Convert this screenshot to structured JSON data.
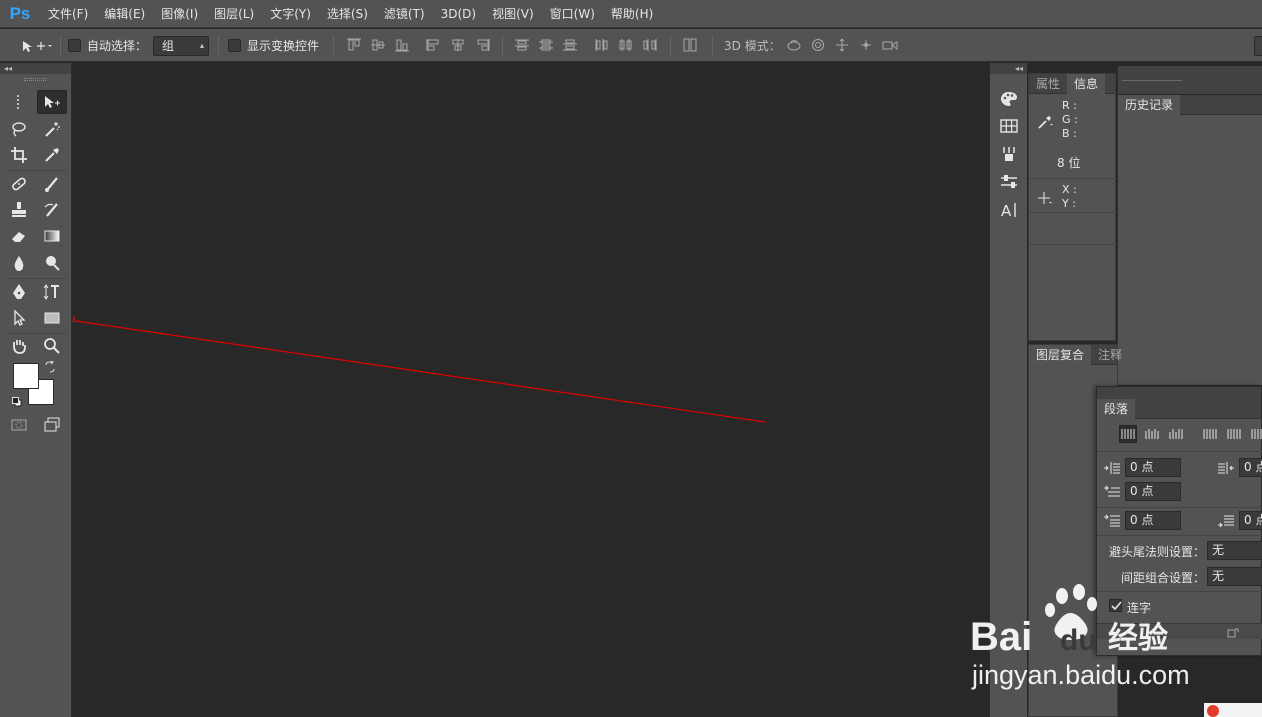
{
  "app": {
    "logo": "Ps"
  },
  "menu": [
    "文件(F)",
    "编辑(E)",
    "图像(I)",
    "图层(L)",
    "文字(Y)",
    "选择(S)",
    "滤镜(T)",
    "3D(D)",
    "视图(V)",
    "窗口(W)",
    "帮助(H)"
  ],
  "options": {
    "auto_select_label": "自动选择：",
    "auto_select_value": "组",
    "show_transform_label": "显示变换控件",
    "mode3d_label": "3D 模式："
  },
  "panel_collapse_glyph": "◂◂",
  "panel_expand_glyph": "▸▸",
  "info_panel": {
    "tabs": [
      "属性",
      "信息"
    ],
    "r_label": "R :",
    "g_label": "G :",
    "b_label": "B :",
    "bit_depth": "8 位",
    "x_label": "X :",
    "y_label": "Y :"
  },
  "history_panel": {
    "tab": "历史记录"
  },
  "comps_panel": {
    "tabs": [
      "图层复合",
      "注释"
    ]
  },
  "paragraph_panel": {
    "tab": "段落",
    "indent_left": "0 点",
    "indent_right": "0 点",
    "indent_first": "0 点",
    "space_before": "0 点",
    "space_after": "0 点",
    "kinsoku_label": "避头尾法则设置：",
    "kinsoku_value": "无",
    "mojikumi_label": "间距组合设置：",
    "mojikumi_value": "无",
    "hyphenate_label": "连字"
  },
  "colors": {
    "ui_panel": "#535353",
    "ui_dark": "#424242",
    "canvas": "#282828",
    "accent_logo": "#31a8ff",
    "annotation_line": "#e00000",
    "foreground_swatch": "#ffffff",
    "background_swatch": "#ffffff"
  },
  "watermark": {
    "brand": "Bai",
    "brand_du": "du",
    "brand_cn": "经验",
    "url": "jingyan.baidu.com"
  }
}
